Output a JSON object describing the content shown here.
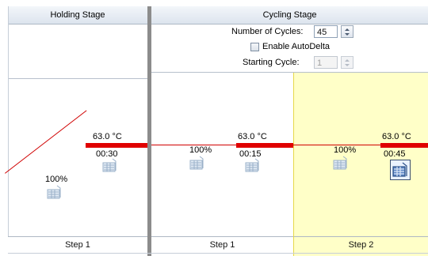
{
  "stages": {
    "holding": {
      "title": "Holding Stage",
      "step": {
        "name": "Step 1",
        "temperature": "63.0 °C",
        "time": "00:30",
        "ramp_rate": "100%"
      }
    },
    "cycling": {
      "title": "Cycling Stage",
      "cycles_label": "Number of Cycles:",
      "cycles_value": "45",
      "autodelta_label": "Enable AutoDelta",
      "autodelta_checked": false,
      "starting_cycle_label": "Starting Cycle:",
      "starting_cycle_value": "1",
      "steps": [
        {
          "name": "Step 1",
          "temperature": "63.0 °C",
          "time": "00:15",
          "ramp_rate": "100%",
          "selected": false
        },
        {
          "name": "Step 2",
          "temperature": "63.0 °C",
          "time": "00:45",
          "ramp_rate": "100%",
          "selected": true
        }
      ]
    }
  },
  "icons": {
    "data_collection": "camera-icon"
  },
  "colors": {
    "temperature_bar": "#e00000",
    "ramp_line": "#d00000",
    "selected_step_bg": "#ffffc8",
    "selected_step_border": "#e6d84a",
    "stage_separator": "#8c8c8c",
    "header_bg": "#e3e9f0"
  }
}
